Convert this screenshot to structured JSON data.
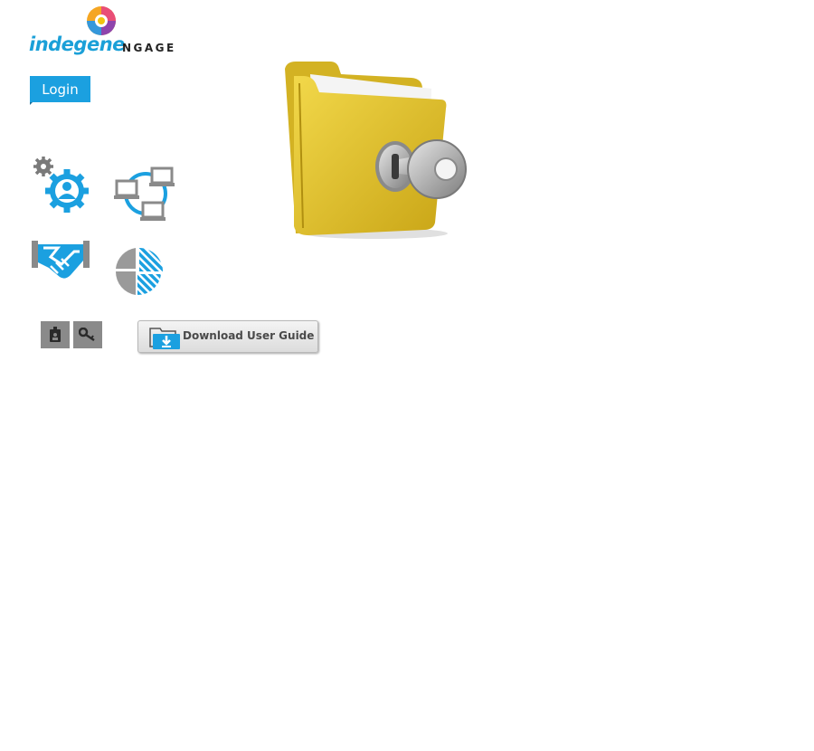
{
  "logo": {
    "brand": "indegene",
    "product": "NGAGE"
  },
  "header": {
    "login_label": "Login"
  },
  "features": [
    {
      "icon": "user-gear-icon"
    },
    {
      "icon": "network-icon"
    },
    {
      "icon": "handshake-icon"
    },
    {
      "icon": "pie-chart-icon"
    }
  ],
  "toolbar": {
    "badge_icon": "id-badge-icon",
    "key_icon": "key-icon"
  },
  "download": {
    "label": "Download User Guide",
    "icon": "folder-download-icon"
  },
  "hero": {
    "icon": "locked-folder-key-icon"
  },
  "colors": {
    "accent": "#1ba0e0",
    "gray": "#8a8a8a",
    "folder": "#e8c93a"
  }
}
